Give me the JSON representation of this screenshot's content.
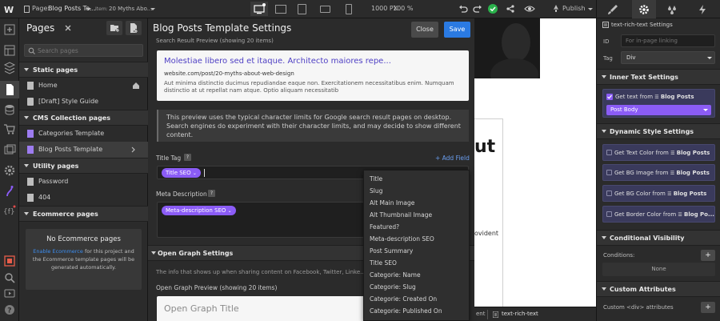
{
  "topbar": {
    "page_label": "Page:",
    "page_name": "Blog Posts Te...",
    "item_label": "Item:",
    "item_name": "20 Myths Abo...",
    "width": "1000 PX",
    "zoom": "100 %",
    "publish": "Publish"
  },
  "pages_panel": {
    "title": "Pages",
    "search_placeholder": "Search pages",
    "sections": [
      {
        "label": "Static pages",
        "items": [
          "Home",
          "[Draft] Style Guide"
        ]
      },
      {
        "label": "CMS Collection pages",
        "items": [
          "Categories Template",
          "Blog Posts Template"
        ]
      },
      {
        "label": "Utility pages",
        "items": [
          "Password",
          "404"
        ]
      },
      {
        "label": "Ecommerce pages",
        "items": []
      }
    ],
    "ecommerce_box": {
      "title": "No Ecommerce pages",
      "link": "Enable Ecommerce",
      "text": " for this project and the Ecommerce template pages will be generated automatically."
    }
  },
  "settings": {
    "title": "Blog Posts Template Settings",
    "close": "Close",
    "save": "Save",
    "search_preview_label": "Search Result Preview (showing 20 items)",
    "search_preview": {
      "title": "Molestiae libero sed et itaque. Architecto maiores repe...",
      "url": "website.com/post/20-myths-about-web-design",
      "desc": "Aut minima distinctio ducimus repudiandae eaque non. Exercitationem necessitatibus enim. Numquam distinctio at ut repellat nam atque. Optio aliquam necessitatib"
    },
    "info_text": "This preview uses the typical character limits for Google search result pages on desktop. Search engines do experiment with their character limits, and may decide to show different content.",
    "title_tag_label": "Title Tag",
    "add_field": "+ Add Field",
    "title_tag_chip": "Title SEO",
    "meta_label": "Meta Description",
    "meta_chip": "Meta-description SEO",
    "og_section": "Open Graph Settings",
    "og_info": "The info that shows up when sharing content on Facebook, Twitter, Linke...",
    "og_preview_label": "Open Graph Preview (showing 20 items)",
    "og_title": "Open Graph Title",
    "help": "?"
  },
  "dropdown": {
    "items": [
      "Title",
      "Slug",
      "Alt Main Image",
      "Alt Thumbnail Image",
      "Featured?",
      "Meta-description SEO",
      "Post Summary",
      "Title SEO",
      "Categorie: Name",
      "Categorie: Slug",
      "Categorie: Created On",
      "Categorie: Published On"
    ]
  },
  "canvas": {
    "heading_fragment": "ut",
    "body_fragment": "ovident",
    "breadcrumb_1": "ent",
    "breadcrumb_2": "text-rich-text"
  },
  "right_panel": {
    "element_name": "text-rich-text Settings",
    "id_label": "ID",
    "id_placeholder": "For in-page linking",
    "tag_label": "Tag",
    "tag_value": "Div",
    "inner_text": "Inner Text Settings",
    "get_text_from": "Get text from",
    "blog_posts": "Blog Posts",
    "post_body": "Post Body",
    "dynamic_style": "Dynamic Style Settings",
    "dyn_rows": [
      "Get Text Color from",
      "Get BG Image from",
      "Get BG Color from",
      "Get Border Color from"
    ],
    "dyn_collection": [
      "Blog Posts",
      "Blog Posts",
      "Blog Posts",
      "Blog Po..."
    ],
    "conditional": "Conditional Visibility",
    "conditions": "Conditions:",
    "none": "None",
    "custom_attrs": "Custom Attributes",
    "custom_div": "Custom <div> attributes",
    "plus": "+"
  },
  "colors": {
    "accent": "#8b5cf6",
    "save_blue": "#2a7ae2",
    "link_purple": "#4e3fc4",
    "green": "#2bb24c"
  }
}
